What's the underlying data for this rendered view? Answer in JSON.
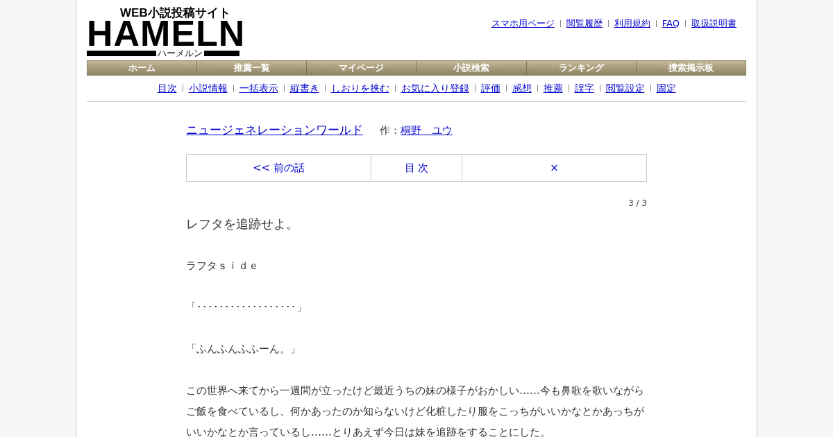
{
  "logo": {
    "tagline": "WEB小説投稿サイト",
    "wordmark": "HAMELN",
    "reading": "ハーメルン"
  },
  "header_links": [
    "スマホ用ページ",
    "閲覧履歴",
    "利用規約",
    "FAQ",
    "取扱説明書"
  ],
  "nav": [
    "ホーム",
    "推薦一覧",
    "マイページ",
    "小説検索",
    "ランキング",
    "捜索掲示板"
  ],
  "novel_links": [
    "目次",
    "小説情報",
    "一括表示",
    "縦書き",
    "しおりを挟む",
    "お気に入り登録",
    "評価",
    "感想",
    "推薦",
    "誤字",
    "閲覧設定",
    "固定"
  ],
  "novel": {
    "title": "ニュージェネレーションワールド",
    "author_label": "作：",
    "author": "桐野　ユウ"
  },
  "pager": [
    "<< 前の話",
    "目 次",
    "×"
  ],
  "page_count": "3 / 3",
  "chapter_title": "レフタを追跡せよ。",
  "paragraphs": [
    "ラフタｓｉｄｅ",
    "「･･････････････････」",
    "「ふんふんふふーん。」",
    "この世界へ来てから一週間が立ったけど最近うちの妹の様子がおかしい‥‥‥今も鼻歌を歌いながらご飯を食べているし、何かあったのか知らないけど化粧したり服をこっちがいいかなとかあっちがいいかなとか言っているし‥‥‥とりあえず今日は妹を追跡をすることにした。"
  ]
}
